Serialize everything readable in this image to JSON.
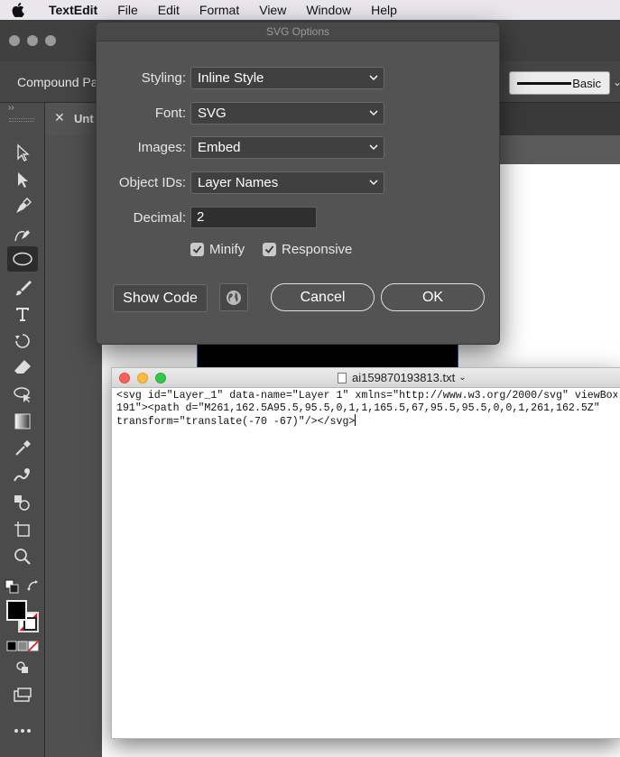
{
  "menubar": {
    "apple_icon": "apple-logo-icon",
    "app_name": "TextEdit",
    "items": [
      "File",
      "Edit",
      "Format",
      "View",
      "Window",
      "Help"
    ]
  },
  "illustrator": {
    "control_bar": {
      "selection_label": "Compound Pat",
      "stroke_profile": "Basic"
    },
    "document_tab": {
      "title": "Unt"
    },
    "toolbar_icons": [
      "selection-tool-icon",
      "direct-selection-tool-icon",
      "pen-tool-icon",
      "curvature-tool-icon",
      "ellipse-tool-icon",
      "paintbrush-tool-icon",
      "type-tool-icon",
      "rotate-tool-icon",
      "eraser-tool-icon",
      "lasso-tool-icon",
      "gradient-tool-icon",
      "eyedropper-tool-icon",
      "puppet-warp-tool-icon",
      "shape-builder-tool-icon",
      "artboard-tool-icon",
      "zoom-tool-icon"
    ],
    "fill_color": "#000000",
    "stroke_color": "none"
  },
  "dialog": {
    "title": "SVG Options",
    "styling": {
      "label": "Styling:",
      "value": "Inline Style"
    },
    "font": {
      "label": "Font:",
      "value": "SVG"
    },
    "images": {
      "label": "Images:",
      "value": "Embed"
    },
    "object_ids": {
      "label": "Object IDs:",
      "value": "Layer Names"
    },
    "decimal": {
      "label": "Decimal:",
      "value": "2"
    },
    "minify": {
      "label": "Minify",
      "checked": true
    },
    "responsive": {
      "label": "Responsive",
      "checked": true
    },
    "show_code_label": "Show Code",
    "web_icon": "globe-icon",
    "cancel_label": "Cancel",
    "ok_label": "OK"
  },
  "textedit": {
    "title": "ai159870193813.txt",
    "content_line1": "<svg id=\"Layer_1\" data-name=\"Layer 1\" xmlns=\"http://www.w3.org/2000/svg\" viewBox",
    "content_line2": "191\"><path d=\"M261,162.5A95.5,95.5,0,1,1,165.5,67,95.5,95.5,0,0,1,261,162.5Z\"",
    "content_line3": "transform=\"translate(-70 -67)\"/></svg>"
  }
}
